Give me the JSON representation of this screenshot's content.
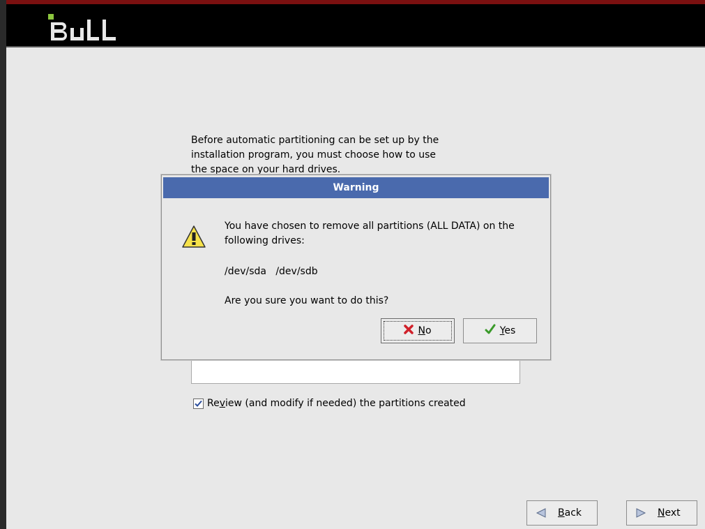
{
  "header": {
    "logo_text": "Bull"
  },
  "main": {
    "intro_line_1": "Before automatic partitioning can be set up by the",
    "intro_line_2": "installation program, you must choose how to use",
    "intro_line_3": "the space on your hard drives.",
    "review_checkbox": {
      "checked": true,
      "label_pre": "Re",
      "label_mnemonic": "v",
      "label_post": "iew (and modify if needed) the partitions created"
    }
  },
  "dialog": {
    "title": "Warning",
    "message_line_1": "You have chosen to remove all partitions (ALL DATA) on the",
    "message_line_2": "following drives:",
    "drives": "/dev/sda   /dev/sdb",
    "question": "Are you sure you want to do this?",
    "no_label_mnemonic": "N",
    "no_label_rest": "o",
    "yes_label_mnemonic": "Y",
    "yes_label_rest": "es",
    "icons": {
      "warning": "warning-triangle-icon",
      "no": "red-x-icon",
      "yes": "green-check-icon"
    }
  },
  "nav": {
    "back_mnemonic": "B",
    "back_rest": "ack",
    "next_mnemonic": "N",
    "next_rest": "ext"
  },
  "colors": {
    "titlebar": "#4a6aad",
    "background": "#e8e8e8",
    "header": "#000000"
  }
}
